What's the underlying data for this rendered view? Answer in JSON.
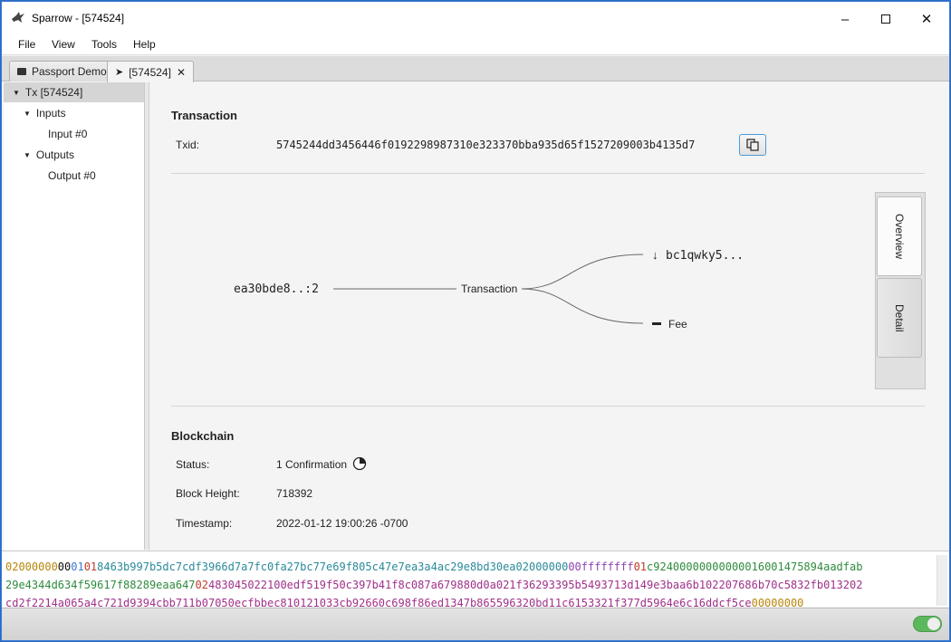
{
  "window": {
    "title": "Sparrow - [574524]"
  },
  "menu": [
    "File",
    "View",
    "Tools",
    "Help"
  ],
  "tabs": [
    {
      "label": "Passport Demo",
      "icon": "wallet-icon"
    },
    {
      "label": "[574524]",
      "icon": "send-icon"
    }
  ],
  "tree": {
    "root": "Tx [574524]",
    "inputs": "Inputs",
    "input0": "Input #0",
    "outputs": "Outputs",
    "output0": "Output #0"
  },
  "transaction": {
    "title": "Transaction",
    "txid_label": "Txid:",
    "txid": "5745244dd3456446f0192298987310e323370bba935d65f1527209003b4135d7"
  },
  "diagram": {
    "input": "ea30bde8..:2",
    "center": "Transaction",
    "output": "bc1qwky5...",
    "fee": "Fee"
  },
  "side_tabs": [
    "Overview",
    "Detail"
  ],
  "blockchain": {
    "title": "Blockchain",
    "status_label": "Status:",
    "status": "1 Confirmation",
    "height_label": "Block Height:",
    "height": "718392",
    "timestamp_label": "Timestamp:",
    "timestamp": "2022-01-12 19:00:26 -0700"
  },
  "hex": {
    "line1": [
      {
        "t": "02000000",
        "c": "#b8860b"
      },
      {
        "t": "00",
        "c": "#111"
      },
      {
        "t": "01",
        "c": "#3b7bd8"
      },
      {
        "t": "01",
        "c": "#c0392b"
      },
      {
        "t": "8463b997b5dc7cdf3966d7a7fc0fa27bc77e69f805c47e7ea3a4ac29e8bd30ea",
        "c": "#2a8a9a"
      },
      {
        "t": "02000000",
        "c": "#2a8a9a"
      },
      {
        "t": "00",
        "c": "#8e44ad"
      },
      {
        "t": "ffffffff",
        "c": "#8e44ad"
      },
      {
        "t": "01",
        "c": "#c0392b"
      },
      {
        "t": "c924000000000000",
        "c": "#2e8b3e"
      },
      {
        "t": "1600147589",
        "c": "#2e8b3e"
      },
      {
        "t": "4aadfab",
        "c": "#2e8b3e"
      }
    ],
    "line2": [
      {
        "t": "29e4344d634f59617f88289eaa647",
        "c": "#2e8b3e"
      },
      {
        "t": "02",
        "c": "#c0392b"
      },
      {
        "t": "483045022100edf519f50c397b41f8c087a679880d0a021f36293395b5493713d149e3baa6b102207686b70c5832fb013202",
        "c": "#a0308a"
      }
    ],
    "line3": [
      {
        "t": "cd2f2214a065a4c721d9394cbb711b07050ecfbbec810121033cb92660c698f86ed1347b865596320bd11c6153321f377d5964e6c16ddcf5ce",
        "c": "#a0308a"
      },
      {
        "t": "00000000",
        "c": "#b8860b"
      }
    ]
  }
}
